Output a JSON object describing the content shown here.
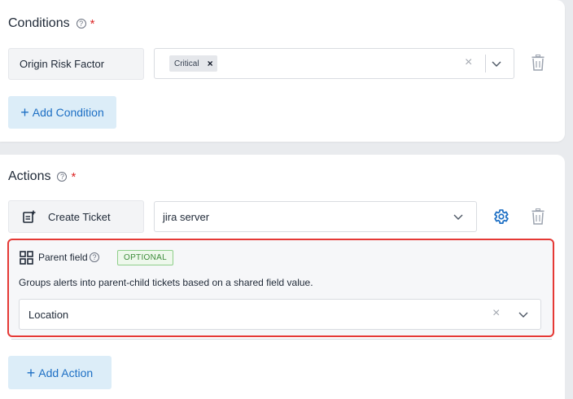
{
  "conditions": {
    "title": "Conditions",
    "help": "?",
    "required_mark": "*",
    "field_label": "Origin Risk Factor",
    "selected_chip": "Critical",
    "chip_remove": "×",
    "clear": "×",
    "add_button": "Add Condition",
    "add_plus": "+"
  },
  "actions": {
    "title": "Actions",
    "help": "?",
    "required_mark": "*",
    "action_label": "Create Ticket",
    "integration_value": "jira server",
    "add_button": "Add Action",
    "add_plus": "+",
    "parent_field": {
      "label": "Parent field",
      "help": "?",
      "badge": "OPTIONAL",
      "description": "Groups alerts into parent-child tickets based on a shared field value.",
      "value": "Location",
      "clear": "×"
    }
  },
  "colors": {
    "accent": "#1d6fc4",
    "required": "#dc2626",
    "highlight_border": "#e53935",
    "optional_badge": "#3c8c3a"
  },
  "icons": {
    "help": "question-circle-icon",
    "trash": "trash-icon",
    "gear": "gear-icon",
    "ticket": "ticket-add-icon",
    "grid": "grid-icon",
    "chevron": "chevron-down-icon",
    "clear": "close-icon"
  }
}
